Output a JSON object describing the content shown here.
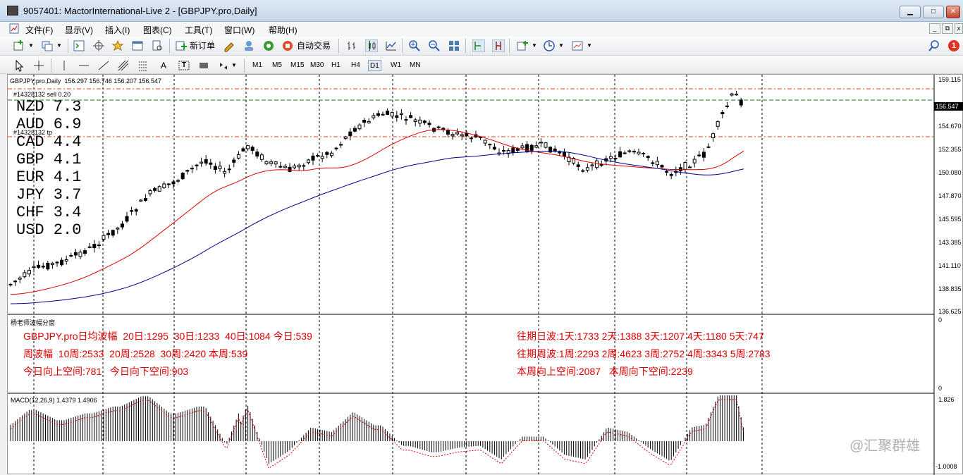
{
  "window": {
    "title": "9057401: MactorInternational-Live 2 - [GBPJPY.pro,Daily]"
  },
  "menu": [
    "文件(F)",
    "显示(V)",
    "插入(I)",
    "图表(C)",
    "工具(T)",
    "窗口(W)",
    "帮助(H)"
  ],
  "toolbar": {
    "new_order": "新订单",
    "auto_trade": "自动交易",
    "notification_count": "1"
  },
  "draw_tools": {
    "text_tool": "A",
    "label_tool": "T"
  },
  "timeframes": [
    "M1",
    "M5",
    "M15",
    "M30",
    "H1",
    "H4",
    "D1",
    "W1",
    "MN"
  ],
  "active_timeframe": "D1",
  "chart": {
    "header": "GBPJPY.pro,Daily  156.297 156.746 156.207 156.547",
    "order_label": "#14328132 sell 0.20",
    "tp_label": "#14328132 tp",
    "price_labels": [
      "159.115",
      "156.547",
      "154.670",
      "152.355",
      "150.080",
      "147.870",
      "145.595",
      "143.385",
      "141.110",
      "138.835",
      "136.625"
    ],
    "current_price": "156.547",
    "strength": [
      {
        "ccy": "NZD",
        "value": "7.3"
      },
      {
        "ccy": "AUD",
        "value": "6.9"
      },
      {
        "ccy": "CAD",
        "value": "4.4"
      },
      {
        "ccy": "GBP",
        "value": "4.1"
      },
      {
        "ccy": "EUR",
        "value": "4.1"
      },
      {
        "ccy": "JPY",
        "value": "3.7"
      },
      {
        "ccy": "CHF",
        "value": "3.4"
      },
      {
        "ccy": "USD",
        "value": "2.0"
      }
    ]
  },
  "indicator": {
    "title": "杨老师波幅分窗",
    "axis_top": "0",
    "axis_bottom": "0",
    "left_lines": [
      "GBPJPY.pro日均波幅  20日:1295  30日:1233  40日:1084 今日:539",
      "周波幅  10周:2533  20周:2528  30周:2420 本周:539",
      "今日向上空间:781   今日向下空间:903"
    ],
    "right_lines": [
      "往期日波:1天:1733 2天:1388 3天:1207 4天:1180 5天:747",
      "往期周波:1周:2293 2周:4623 3周:2752 4周:3343 5周:2783",
      "本周向上空间:2087   本周向下空间:2239"
    ]
  },
  "macd": {
    "label": "MACD(12,26,9) 1.4379 1.4906",
    "axis_top": "1.826",
    "axis_bottom": "-1.0008"
  },
  "watermark": "@汇聚群雄",
  "colors": {
    "ma_fast": "#e00000",
    "ma_slow": "#00008b",
    "text_red": "#e00000",
    "grid": "#000000"
  }
}
